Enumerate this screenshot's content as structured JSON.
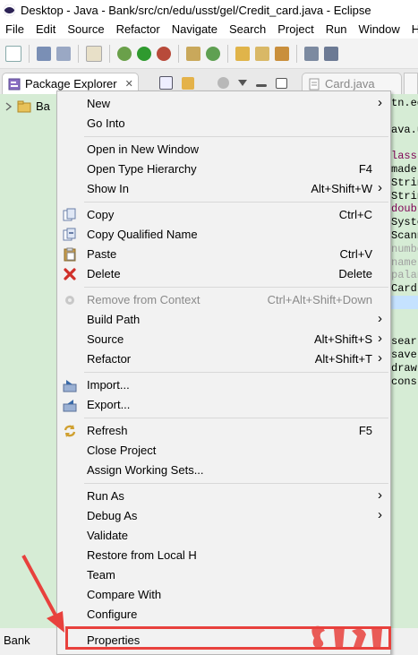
{
  "window": {
    "title": "Desktop - Java - Bank/src/cn/edu/usst/gel/Credit_card.java - Eclipse"
  },
  "menubar": [
    "File",
    "Edit",
    "Source",
    "Refactor",
    "Navigate",
    "Search",
    "Project",
    "Run",
    "Window",
    "H"
  ],
  "views": {
    "package_explorer": {
      "label": "Package Explorer",
      "close": "✕"
    },
    "editor_tab": {
      "label": "Card.java"
    }
  },
  "tree": {
    "project_label": "Ba"
  },
  "status_bar": {
    "label": "Bank"
  },
  "code_peek": [
    "tn.ed",
    "",
    "ava.u",
    "",
    "lass",
    " made",
    "Strin",
    "Strin",
    "doubl",
    "Syste",
    "Scann",
    "numbe",
    "name",
    "palan",
    "Card",
    "",
    "",
    "",
    " sear",
    " save",
    " draw",
    " cons"
  ],
  "context_menu": {
    "items": [
      {
        "label": "New",
        "submenu": true,
        "icon": "none"
      },
      {
        "label": "Go Into",
        "icon": "none"
      },
      {
        "separator": true
      },
      {
        "label": "Open in New Window",
        "icon": "none"
      },
      {
        "label": "Open Type Hierarchy",
        "accel": "F4",
        "icon": "none"
      },
      {
        "label": "Show In",
        "accel": "Alt+Shift+W",
        "submenu": true,
        "icon": "none"
      },
      {
        "separator": true
      },
      {
        "label": "Copy",
        "accel": "Ctrl+C",
        "icon": "copy-icon"
      },
      {
        "label": "Copy Qualified Name",
        "icon": "copy-qualified-icon"
      },
      {
        "label": "Paste",
        "accel": "Ctrl+V",
        "icon": "paste-icon"
      },
      {
        "label": "Delete",
        "accel": "Delete",
        "icon": "delete-icon"
      },
      {
        "separator": true
      },
      {
        "label": "Remove from Context",
        "accel": "Ctrl+Alt+Shift+Down",
        "disabled": true,
        "icon": "remove-context-icon"
      },
      {
        "label": "Build Path",
        "submenu": true,
        "icon": "none"
      },
      {
        "label": "Source",
        "accel": "Alt+Shift+S",
        "submenu": true,
        "icon": "none"
      },
      {
        "label": "Refactor",
        "accel": "Alt+Shift+T",
        "submenu": true,
        "icon": "none"
      },
      {
        "separator": true
      },
      {
        "label": "Import...",
        "icon": "import-icon"
      },
      {
        "label": "Export...",
        "icon": "export-icon"
      },
      {
        "separator": true
      },
      {
        "label": "Refresh",
        "accel": "F5",
        "icon": "refresh-icon"
      },
      {
        "label": "Close Project",
        "icon": "none"
      },
      {
        "label": "Assign Working Sets...",
        "icon": "none"
      },
      {
        "separator": true
      },
      {
        "label": "Run As",
        "submenu": true,
        "icon": "none"
      },
      {
        "label": "Debug As",
        "submenu": true,
        "icon": "none"
      },
      {
        "label": "Validate",
        "icon": "none"
      },
      {
        "label": "Restore from Local H",
        "icon": "none"
      },
      {
        "label": "Team",
        "icon": "none"
      },
      {
        "label": "Compare With",
        "icon": "none"
      },
      {
        "label": "Configure",
        "icon": "none"
      },
      {
        "separator": true
      },
      {
        "label": "Properties",
        "icon": "none",
        "highlighted": true
      }
    ]
  },
  "colors": {
    "annotation": "#e8413d",
    "package_pane": "#d6ecd5",
    "menu_bg": "#f2f2f2"
  }
}
